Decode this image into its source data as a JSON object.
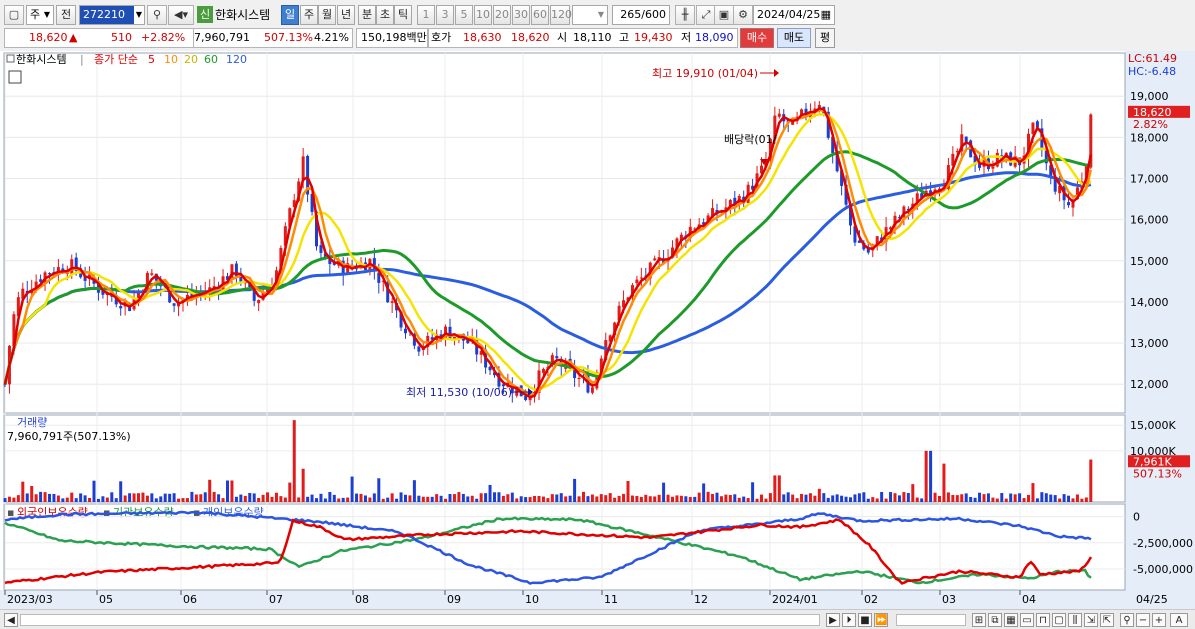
{
  "toolbar": {
    "period_type": "주",
    "prev_label": "전",
    "stock_code": "272210",
    "badge": "신",
    "stock_name": "한화시스템",
    "intervals": [
      "일",
      "주",
      "월",
      "년",
      "분",
      "초",
      "틱"
    ],
    "numbers": [
      "1",
      "3",
      "5",
      "10",
      "20",
      "30",
      "60",
      "120"
    ],
    "count": "265",
    "count_total": "/600",
    "date": "2024/04/25"
  },
  "quote": {
    "price": "18,620",
    "arrow": "▲",
    "change": "510",
    "change_pct": "+2.82%",
    "volume": "7,960,791",
    "volume_pct": "507.13%",
    "turnover_pct": "4.21%",
    "amount": "150,198백만",
    "hoga_label": "호가",
    "ask": "18,630",
    "bid": "18,620",
    "open_label": "시",
    "open": "18,110",
    "high_label": "고",
    "high": "19,430",
    "low_label": "저",
    "low": "18,090",
    "buy": "매수",
    "sell": "매도",
    "avg": "평"
  },
  "legend": {
    "name": "한화시스템",
    "series": "종가 단순",
    "ma5": "5",
    "ma10": "10",
    "ma20": "20",
    "ma60": "60",
    "ma120": "120"
  },
  "annotations": {
    "high": "최고 19,910 (01/04)",
    "low": "최저 11,530 (10/06)",
    "dividend": "배당락(01/"
  },
  "right_axis": {
    "lc": "LC:61.49",
    "hc": "HC:-6.48",
    "price_ticks": [
      "19,000",
      "18,000",
      "17,000",
      "16,000",
      "15,000",
      "14,000",
      "13,000",
      "12,000"
    ],
    "price_tag": "18,620",
    "price_tag_pct": "2.82%",
    "vol_ticks": [
      "15,000K",
      "10,000K"
    ],
    "vol_tag": "7,961K",
    "vol_tag_pct": "507.13%",
    "holding_ticks": [
      "0",
      "-2,500,000",
      "-5,000,000"
    ]
  },
  "volume_panel": {
    "title": "거래량",
    "value": "7,960,791주(507.13%)"
  },
  "holding_panel": {
    "foreign": "외국인보유수량",
    "institution": "기관보유수량",
    "individual": "개인보유수량"
  },
  "x_axis": [
    "2023/03",
    "05",
    "06",
    "07",
    "08",
    "09",
    "10",
    "11",
    "12",
    "2024/01",
    "02",
    "03",
    "04"
  ],
  "x_axis_end": "04/25",
  "colors": {
    "up": "#e21b1b",
    "down": "#1d3fd1",
    "ma5": "#e00000",
    "ma10": "#ff8c00",
    "ma20": "#f5e400",
    "ma60": "#1e9a2a",
    "ma120": "#2b5de0",
    "foreign": "#e00000",
    "institution": "#2aa050",
    "individual": "#2d55e0"
  }
}
